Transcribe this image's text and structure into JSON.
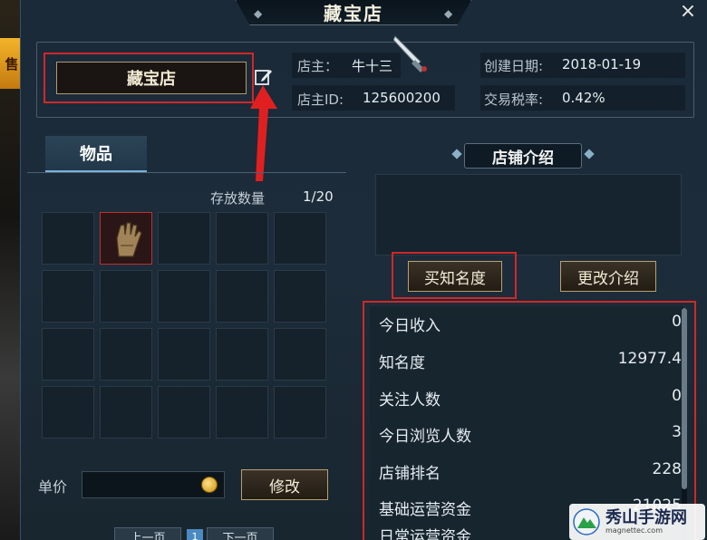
{
  "window": {
    "title": "藏宝店",
    "close_glyph": "×",
    "side_tag": "售"
  },
  "shop_info": {
    "shop_name": "藏宝店",
    "owner_label": "店主：",
    "owner_value": "牛十三",
    "owner_id_label": "店主ID:",
    "owner_id_value": "125600200",
    "created_label": "创建日期:",
    "created_value": "2018-01-19",
    "tax_label": "交易税率:",
    "tax_value": "0.42%"
  },
  "items_tab": {
    "tab_label": "物品",
    "storage_label": "存放数量",
    "storage_value": "1/20",
    "slots": [
      "",
      "glove",
      "",
      "",
      "",
      "",
      "",
      "",
      "",
      "",
      "",
      "",
      "",
      "",
      "",
      "",
      "",
      "",
      "",
      ""
    ]
  },
  "price": {
    "label": "单价",
    "modify_button": "修改"
  },
  "pager": {
    "prev": "上一页",
    "page": "1",
    "next": "下一页"
  },
  "intro": {
    "title": "店铺介绍",
    "buy_fame_button": "买知名度",
    "edit_intro_button": "更改介绍"
  },
  "stats": [
    {
      "label": "今日收入",
      "value": "0"
    },
    {
      "label": "知名度",
      "value": "12977.4"
    },
    {
      "label": "关注人数",
      "value": "0"
    },
    {
      "label": "今日浏览人数",
      "value": "3"
    },
    {
      "label": "店铺排名",
      "value": "228"
    },
    {
      "label": "基础运营资金",
      "value": "21025"
    },
    {
      "label": "日常运营资金",
      "value": ""
    }
  ],
  "watermark": {
    "text": "秀山手游网",
    "sub": "magnettec.com"
  },
  "colors": {
    "highlight_red": "#d02828",
    "gold_border": "#b8a070",
    "tab_blue": "#7ab0d8"
  },
  "icons": {
    "edit": "edit-icon",
    "coin": "coin-icon",
    "close": "close-icon",
    "cursor": "sword-cursor-icon"
  }
}
